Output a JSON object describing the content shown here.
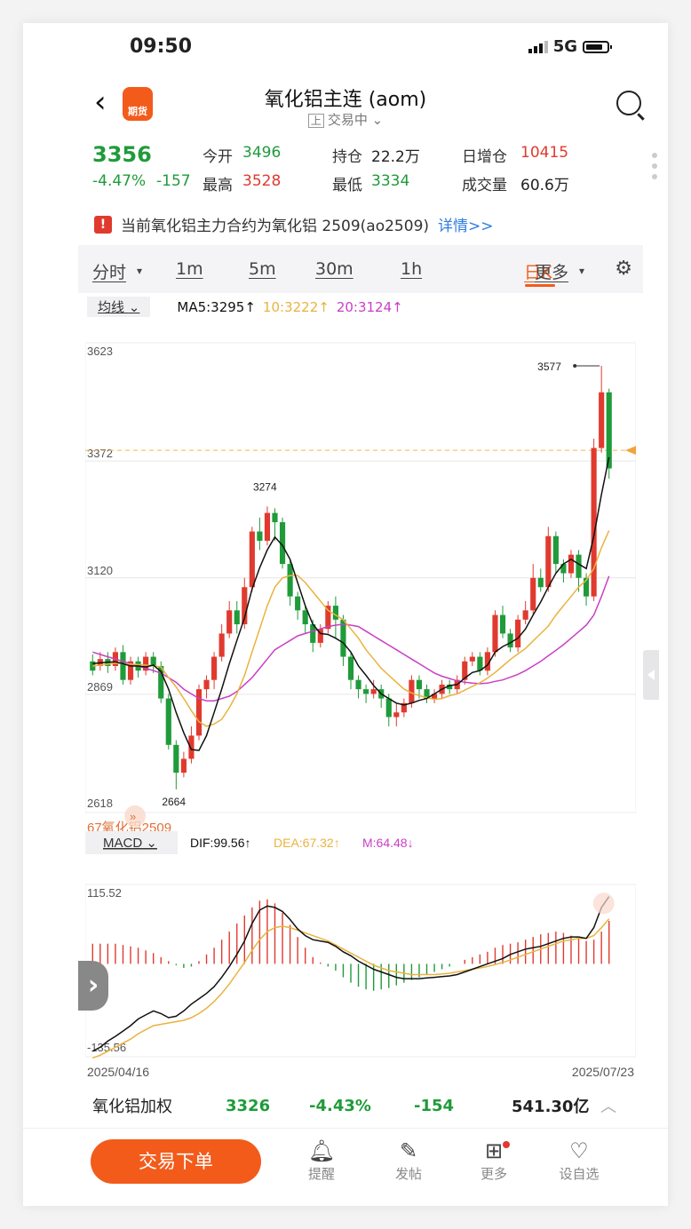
{
  "status": {
    "time": "09:50",
    "network": "5G"
  },
  "header": {
    "title": "氧化铝主连 (aom)",
    "subtitle_box": "上",
    "subtitle": "交易中",
    "logo_text": "期货"
  },
  "quote": {
    "price": "3356",
    "change_pct": "-4.47%",
    "change": "-157",
    "open_label": "今开",
    "open": "3496",
    "high_label": "最高",
    "high": "3528",
    "oi_label": "持仓",
    "oi": "22.2万",
    "low_label": "最低",
    "low": "3334",
    "oi_change_label": "日增仓",
    "oi_change": "10415",
    "volume_label": "成交量",
    "volume": "60.6万"
  },
  "notice": {
    "text": "当前氧化铝主力合约为氧化铝 2509(ao2509)",
    "detail": "详情>>"
  },
  "tabs": [
    {
      "label": "分时"
    },
    {
      "label": "1m"
    },
    {
      "label": "5m"
    },
    {
      "label": "30m"
    },
    {
      "label": "1h"
    },
    {
      "label": "日K"
    },
    {
      "label": "更多"
    }
  ],
  "ma": {
    "button": "均线",
    "ma5": "MA5:3295↑",
    "ma10": "10:3222↑",
    "ma20": "20:3124↑"
  },
  "macd": {
    "button": "MACD",
    "dif": "DIF:99.56↑",
    "dea": "DEA:67.32↑",
    "m": "M:64.48↓",
    "top": "115.52",
    "bottom": "-135.56"
  },
  "chart_data": {
    "type": "candlestick",
    "contract_label": "67氧化铝2509",
    "y_ticks": [
      "3623",
      "3372",
      "3120",
      "2869",
      "2618"
    ],
    "ylim": [
      2618,
      3623
    ],
    "annotations": [
      {
        "label": "3577",
        "value": 3577
      },
      {
        "label": "3274",
        "value": 3274
      },
      {
        "label": "2664",
        "value": 2664
      }
    ],
    "x_start": "2025/04/16",
    "x_end": "2025/07/23",
    "candles": [
      [
        2940,
        2920,
        2955,
        2910
      ],
      [
        2930,
        2945,
        2960,
        2920
      ],
      [
        2945,
        2930,
        2960,
        2915
      ],
      [
        2930,
        2960,
        2970,
        2920
      ],
      [
        2960,
        2900,
        2975,
        2890
      ],
      [
        2900,
        2940,
        2950,
        2890
      ],
      [
        2940,
        2920,
        2950,
        2905
      ],
      [
        2920,
        2950,
        2960,
        2910
      ],
      [
        2950,
        2930,
        2960,
        2915
      ],
      [
        2930,
        2860,
        2940,
        2850
      ],
      [
        2860,
        2760,
        2870,
        2750
      ],
      [
        2760,
        2700,
        2770,
        2664
      ],
      [
        2700,
        2730,
        2745,
        2690
      ],
      [
        2730,
        2780,
        2800,
        2720
      ],
      [
        2780,
        2880,
        2890,
        2770
      ],
      [
        2880,
        2900,
        2910,
        2860
      ],
      [
        2900,
        2950,
        2960,
        2880
      ],
      [
        2950,
        3000,
        3020,
        2940
      ],
      [
        3000,
        3050,
        3070,
        2990
      ],
      [
        3050,
        3020,
        3070,
        3000
      ],
      [
        3020,
        3100,
        3120,
        3010
      ],
      [
        3100,
        3220,
        3230,
        3090
      ],
      [
        3220,
        3200,
        3250,
        3180
      ],
      [
        3200,
        3260,
        3274,
        3190
      ],
      [
        3260,
        3240,
        3270,
        3200
      ],
      [
        3240,
        3150,
        3250,
        3140
      ],
      [
        3150,
        3080,
        3160,
        3060
      ],
      [
        3080,
        3050,
        3090,
        3030
      ],
      [
        3050,
        3020,
        3060,
        3000
      ],
      [
        3020,
        2980,
        3030,
        2960
      ],
      [
        2980,
        3010,
        3020,
        2970
      ],
      [
        3010,
        3060,
        3070,
        3000
      ],
      [
        3060,
        3030,
        3080,
        2990
      ],
      [
        3030,
        2950,
        3040,
        2930
      ],
      [
        2950,
        2900,
        2960,
        2880
      ],
      [
        2900,
        2880,
        2910,
        2860
      ],
      [
        2880,
        2870,
        2890,
        2850
      ],
      [
        2870,
        2880,
        2900,
        2860
      ],
      [
        2880,
        2860,
        2890,
        2840
      ],
      [
        2860,
        2820,
        2870,
        2800
      ],
      [
        2820,
        2830,
        2850,
        2800
      ],
      [
        2830,
        2850,
        2860,
        2820
      ],
      [
        2850,
        2900,
        2910,
        2840
      ],
      [
        2900,
        2880,
        2910,
        2860
      ],
      [
        2880,
        2860,
        2890,
        2850
      ],
      [
        2860,
        2870,
        2880,
        2850
      ],
      [
        2870,
        2890,
        2900,
        2860
      ],
      [
        2890,
        2880,
        2900,
        2870
      ],
      [
        2880,
        2900,
        2910,
        2870
      ],
      [
        2900,
        2940,
        2950,
        2890
      ],
      [
        2940,
        2950,
        2960,
        2930
      ],
      [
        2950,
        2920,
        2960,
        2910
      ],
      [
        2920,
        2960,
        2970,
        2910
      ],
      [
        2960,
        3040,
        3050,
        2950
      ],
      [
        3040,
        3000,
        3060,
        2990
      ],
      [
        3000,
        2970,
        3010,
        2960
      ],
      [
        2970,
        3030,
        3040,
        2960
      ],
      [
        3030,
        3050,
        3070,
        3020
      ],
      [
        3050,
        3120,
        3150,
        3040
      ],
      [
        3120,
        3100,
        3140,
        3090
      ],
      [
        3100,
        3210,
        3230,
        3090
      ],
      [
        3210,
        3150,
        3220,
        3130
      ],
      [
        3150,
        3130,
        3160,
        3110
      ],
      [
        3130,
        3170,
        3180,
        3120
      ],
      [
        3170,
        3120,
        3180,
        3090
      ],
      [
        3120,
        3080,
        3130,
        3060
      ],
      [
        3080,
        3400,
        3420,
        3070
      ],
      [
        3400,
        3520,
        3577,
        3390
      ],
      [
        3520,
        3356,
        3528,
        3334
      ]
    ],
    "ma5": [
      2935,
      2937,
      2938,
      2939,
      2935,
      2930,
      2930,
      2928,
      2932,
      2918,
      2880,
      2830,
      2786,
      2750,
      2748,
      2780,
      2830,
      2880,
      2935,
      2985,
      3034,
      3096,
      3142,
      3180,
      3208,
      3190,
      3160,
      3110,
      3060,
      3020,
      3000,
      2998,
      2990,
      2980,
      2960,
      2930,
      2910,
      2888,
      2870,
      2860,
      2850,
      2846,
      2850,
      2856,
      2860,
      2870,
      2880,
      2888,
      2890,
      2904,
      2916,
      2920,
      2932,
      2960,
      2972,
      2980,
      2990,
      3010,
      3040,
      3068,
      3100,
      3130,
      3150,
      3160,
      3150,
      3140,
      3210,
      3300,
      3380
    ],
    "ma10": [
      2930,
      2932,
      2934,
      2936,
      2935,
      2934,
      2933,
      2932,
      2931,
      2928,
      2905,
      2885,
      2860,
      2834,
      2810,
      2800,
      2805,
      2815,
      2840,
      2870,
      2910,
      2960,
      3010,
      3060,
      3100,
      3120,
      3125,
      3125,
      3110,
      3090,
      3070,
      3050,
      3040,
      3030,
      3010,
      2990,
      2965,
      2945,
      2925,
      2910,
      2895,
      2880,
      2872,
      2866,
      2862,
      2858,
      2860,
      2866,
      2870,
      2878,
      2886,
      2894,
      2904,
      2916,
      2930,
      2944,
      2956,
      2968,
      2984,
      3000,
      3016,
      3040,
      3060,
      3080,
      3100,
      3115,
      3140,
      3185,
      3222
    ],
    "ma20": [
      2960,
      2955,
      2950,
      2945,
      2940,
      2935,
      2930,
      2925,
      2920,
      2915,
      2905,
      2895,
      2880,
      2870,
      2860,
      2855,
      2855,
      2860,
      2865,
      2875,
      2890,
      2905,
      2925,
      2945,
      2965,
      2975,
      2985,
      2995,
      3000,
      3005,
      3010,
      3015,
      3018,
      3020,
      3018,
      3015,
      3005,
      2995,
      2985,
      2975,
      2965,
      2955,
      2945,
      2935,
      2925,
      2915,
      2908,
      2903,
      2898,
      2895,
      2893,
      2892,
      2893,
      2897,
      2900,
      2906,
      2912,
      2920,
      2930,
      2940,
      2952,
      2964,
      2976,
      2990,
      3004,
      3018,
      3040,
      3080,
      3124
    ],
    "macd_hist": [
      30,
      30,
      30,
      30,
      28,
      26,
      24,
      20,
      16,
      10,
      4,
      -2,
      -6,
      -4,
      4,
      14,
      24,
      36,
      48,
      60,
      72,
      84,
      94,
      96,
      90,
      76,
      58,
      40,
      24,
      10,
      2,
      -4,
      -10,
      -20,
      -28,
      -34,
      -38,
      -40,
      -38,
      -36,
      -32,
      -28,
      -24,
      -20,
      -16,
      -12,
      -8,
      -4,
      0,
      6,
      10,
      14,
      18,
      24,
      28,
      30,
      32,
      36,
      40,
      44,
      46,
      48,
      46,
      42,
      38,
      34,
      36,
      48,
      64
    ],
    "dif_line": [
      -130,
      -124,
      -115,
      -108,
      -100,
      -92,
      -82,
      -76,
      -70,
      -74,
      -80,
      -78,
      -70,
      -60,
      -52,
      -44,
      -34,
      -20,
      -4,
      14,
      34,
      60,
      80,
      86,
      84,
      78,
      66,
      52,
      42,
      36,
      34,
      32,
      26,
      18,
      12,
      4,
      -2,
      -8,
      -12,
      -16,
      -20,
      -22,
      -22,
      -22,
      -21,
      -20,
      -19,
      -18,
      -16,
      -12,
      -8,
      -4,
      0,
      4,
      8,
      14,
      18,
      22,
      24,
      26,
      30,
      34,
      38,
      40,
      40,
      38,
      54,
      84,
      100
    ],
    "dea_line": [
      -140,
      -136,
      -130,
      -124,
      -118,
      -112,
      -104,
      -98,
      -92,
      -90,
      -88,
      -86,
      -84,
      -80,
      -74,
      -66,
      -56,
      -44,
      -30,
      -14,
      2,
      20,
      36,
      48,
      54,
      56,
      54,
      50,
      46,
      42,
      38,
      34,
      28,
      22,
      16,
      10,
      4,
      -2,
      -6,
      -10,
      -12,
      -14,
      -16,
      -16,
      -16,
      -16,
      -15,
      -14,
      -12,
      -10,
      -8,
      -6,
      -4,
      -1,
      2,
      6,
      10,
      14,
      18,
      22,
      26,
      30,
      34,
      36,
      38,
      38,
      42,
      54,
      67
    ]
  },
  "bottom_quote": {
    "name": "氧化铝加权",
    "price": "3326",
    "pct": "-4.43%",
    "change": "-154",
    "amount": "541.30亿"
  },
  "bottom_nav": {
    "trade": "交易下单",
    "alert": "提醒",
    "post": "发帖",
    "more": "更多",
    "watch": "设自选"
  }
}
